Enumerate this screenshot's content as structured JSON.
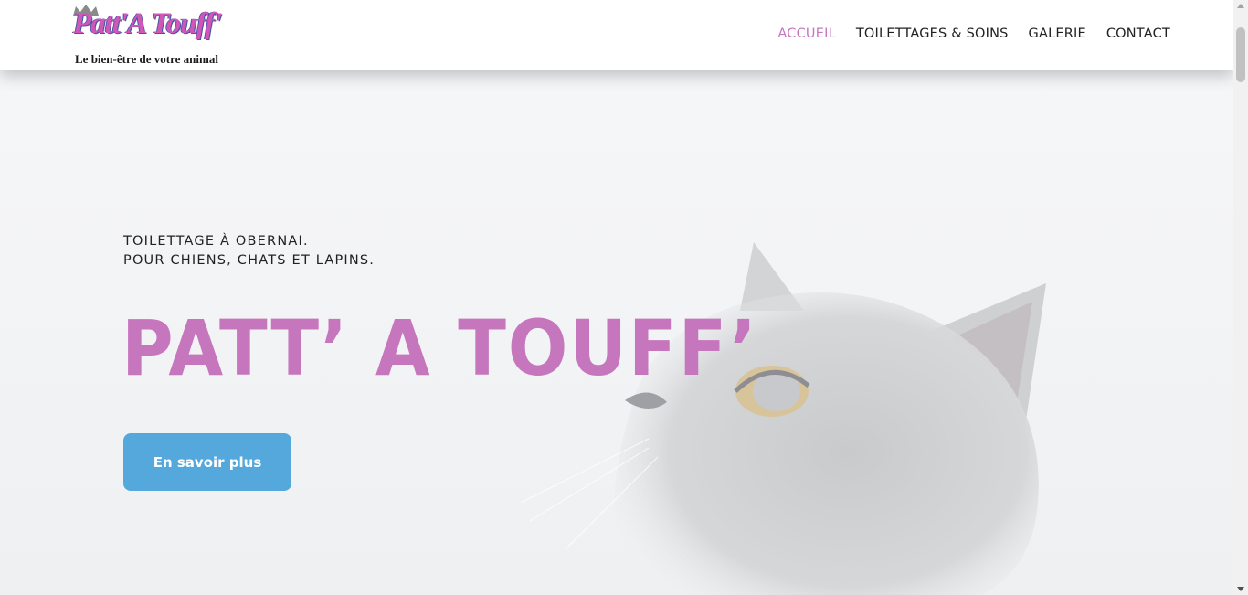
{
  "header": {
    "logo_title": "Patt'A Touff'",
    "logo_tagline": "Le bien-être de votre animal",
    "nav": [
      {
        "label": "ACCUEIL",
        "active": true
      },
      {
        "label": "TOILETTAGES & SOINS",
        "active": false
      },
      {
        "label": "GALERIE",
        "active": false
      },
      {
        "label": "CONTACT",
        "active": false
      }
    ]
  },
  "hero": {
    "kicker_line1": "TOILETTAGE À OBERNAI.",
    "kicker_line2": "POUR CHIENS, CHATS ET LAPINS.",
    "headline": "PATT’ A TOUFF’",
    "cta_label": "En savoir plus",
    "image": "grey-cat-photo"
  },
  "colors": {
    "accent": "#c676bd",
    "button": "#55a8dc",
    "text": "#222222"
  }
}
